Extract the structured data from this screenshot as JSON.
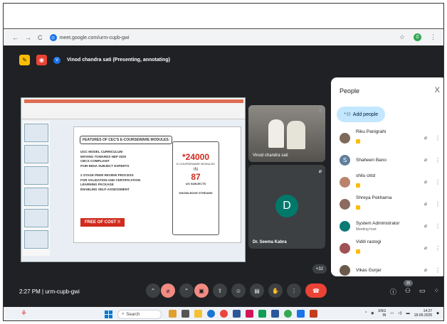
{
  "browser": {
    "url": "meet.google.com/urm-cupb-gwi",
    "nav": [
      "←",
      "→",
      "C"
    ],
    "site_icon_glyph": "⊙",
    "star_glyph": "☆",
    "profile_initial": "0",
    "menu_glyph": "⋮"
  },
  "meeting": {
    "presenter_initial": "V",
    "presenter_label": "Vinod chandra sati (Presenting, annotating)",
    "time": "2:27 PM",
    "separator": "|",
    "code": "urm-cupb-gwi",
    "more_count": "+32",
    "participant_count": "35"
  },
  "slide": {
    "title": "FEATURES OF CEC'S E-COURSEWARE MODULES:",
    "points": [
      "UGC MODEL CURRICULUM",
      "MOVING TOWARDS NEP 2020",
      "CBCS COMPLIANT",
      "FAIR-INDIA SUBJECT EXPERTS",
      "2 STAGE PEER REVIEW PROCESS",
      "FOR VALIDATION AND CERTIFICATION",
      "LEARNING PACKAGE",
      "ENABLING SELF-ASSESSMENT"
    ],
    "free_label": "FREE OF COST !!",
    "count_modules": "*24000",
    "modules_label": "E-COURSEWARE MODULES",
    "in_label": "IN",
    "count_subjects": "87",
    "subjects_label": "UG SUBJECTS",
    "streams_label": "KNOWLEDGE STREAMS"
  },
  "tiles": [
    {
      "name": "Vinod chandra sati"
    },
    {
      "name": "Dr. Seema Kabra",
      "initial": "D"
    }
  ],
  "people": {
    "title": "People",
    "close": "X",
    "add_label": "Add people",
    "list": [
      {
        "name": "Riku Panigrahi",
        "sub": "",
        "initial": "",
        "color": "#7d6a5a"
      },
      {
        "name": "Shaheen Bano",
        "sub": "",
        "initial": "S",
        "color": "#5f7f9b"
      },
      {
        "name": "shilu cktd",
        "sub": "",
        "initial": "",
        "color": "#b9846b"
      },
      {
        "name": "Shreya Pokharna",
        "sub": "",
        "initial": "",
        "color": "#8a6b5d"
      },
      {
        "name": "System Administrator",
        "sub": "Meeting host",
        "initial": "",
        "color": "#0b7a75"
      },
      {
        "name": "Viditi rastogi",
        "sub": "",
        "initial": "",
        "color": "#a05252"
      },
      {
        "name": "Vikas Gurjar",
        "sub": "",
        "initial": "",
        "color": "#6b5a4a"
      }
    ]
  },
  "taskbar": {
    "search": "Search",
    "lang": "ENG",
    "region": "IN",
    "clock": "14:27",
    "date": "18-06-2025"
  },
  "colors": {
    "meet_bg": "#202124",
    "end_call": "#ea4335",
    "muted": "#f28b82"
  }
}
